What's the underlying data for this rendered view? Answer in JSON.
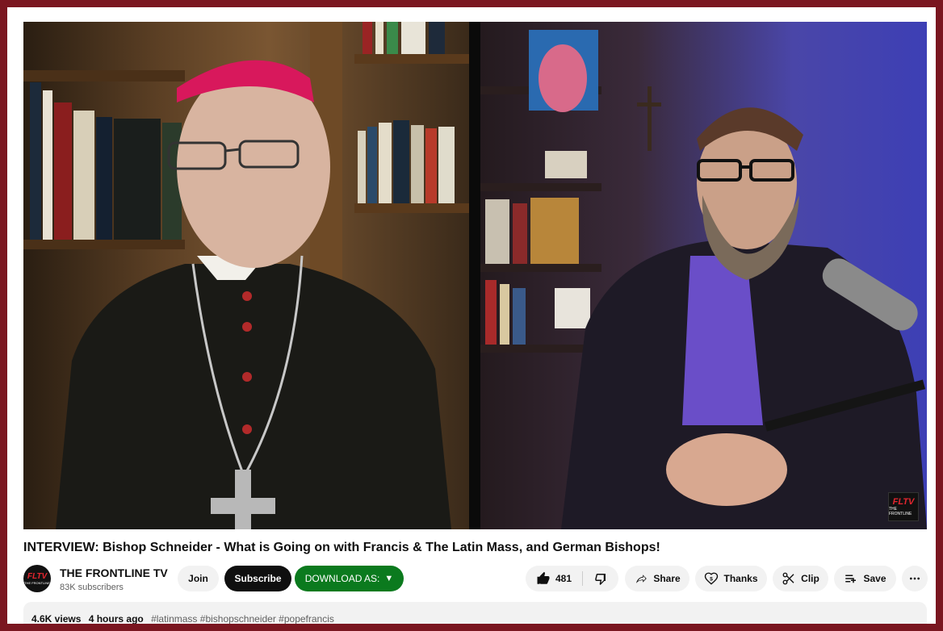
{
  "video": {
    "watermark_top": "FLTV",
    "watermark_bottom": "THE FRONTLINE"
  },
  "title": "INTERVIEW: Bishop Schneider - What is Going on with Francis & The Latin Mass, and German Bishops!",
  "channel": {
    "avatar_top": "FLTV",
    "avatar_bottom": "THE FRONTLINE",
    "name": "THE FRONTLINE TV",
    "subscribers": "83K subscribers"
  },
  "buttons": {
    "join": "Join",
    "subscribe": "Subscribe",
    "download": "DOWNLOAD AS:",
    "download_arrow": "▼",
    "like_count": "481",
    "share": "Share",
    "thanks": "Thanks",
    "clip": "Clip",
    "save": "Save"
  },
  "icons": {
    "like": "thumb-up-icon",
    "dislike": "thumb-down-icon",
    "share": "share-arrow-icon",
    "thanks": "heart-dollar-icon",
    "clip": "scissors-icon",
    "save": "playlist-add-icon",
    "more": "more-horizontal-icon"
  },
  "description": {
    "views": "4.6K views",
    "time": "4 hours ago",
    "hashtags": "#latinmass #bishopschneider #popefrancis"
  },
  "colors": {
    "border": "#7a1620",
    "download_green": "#0b7a1e",
    "subscribe_black": "#0f0f0f",
    "button_gray": "#f2f2f2"
  }
}
